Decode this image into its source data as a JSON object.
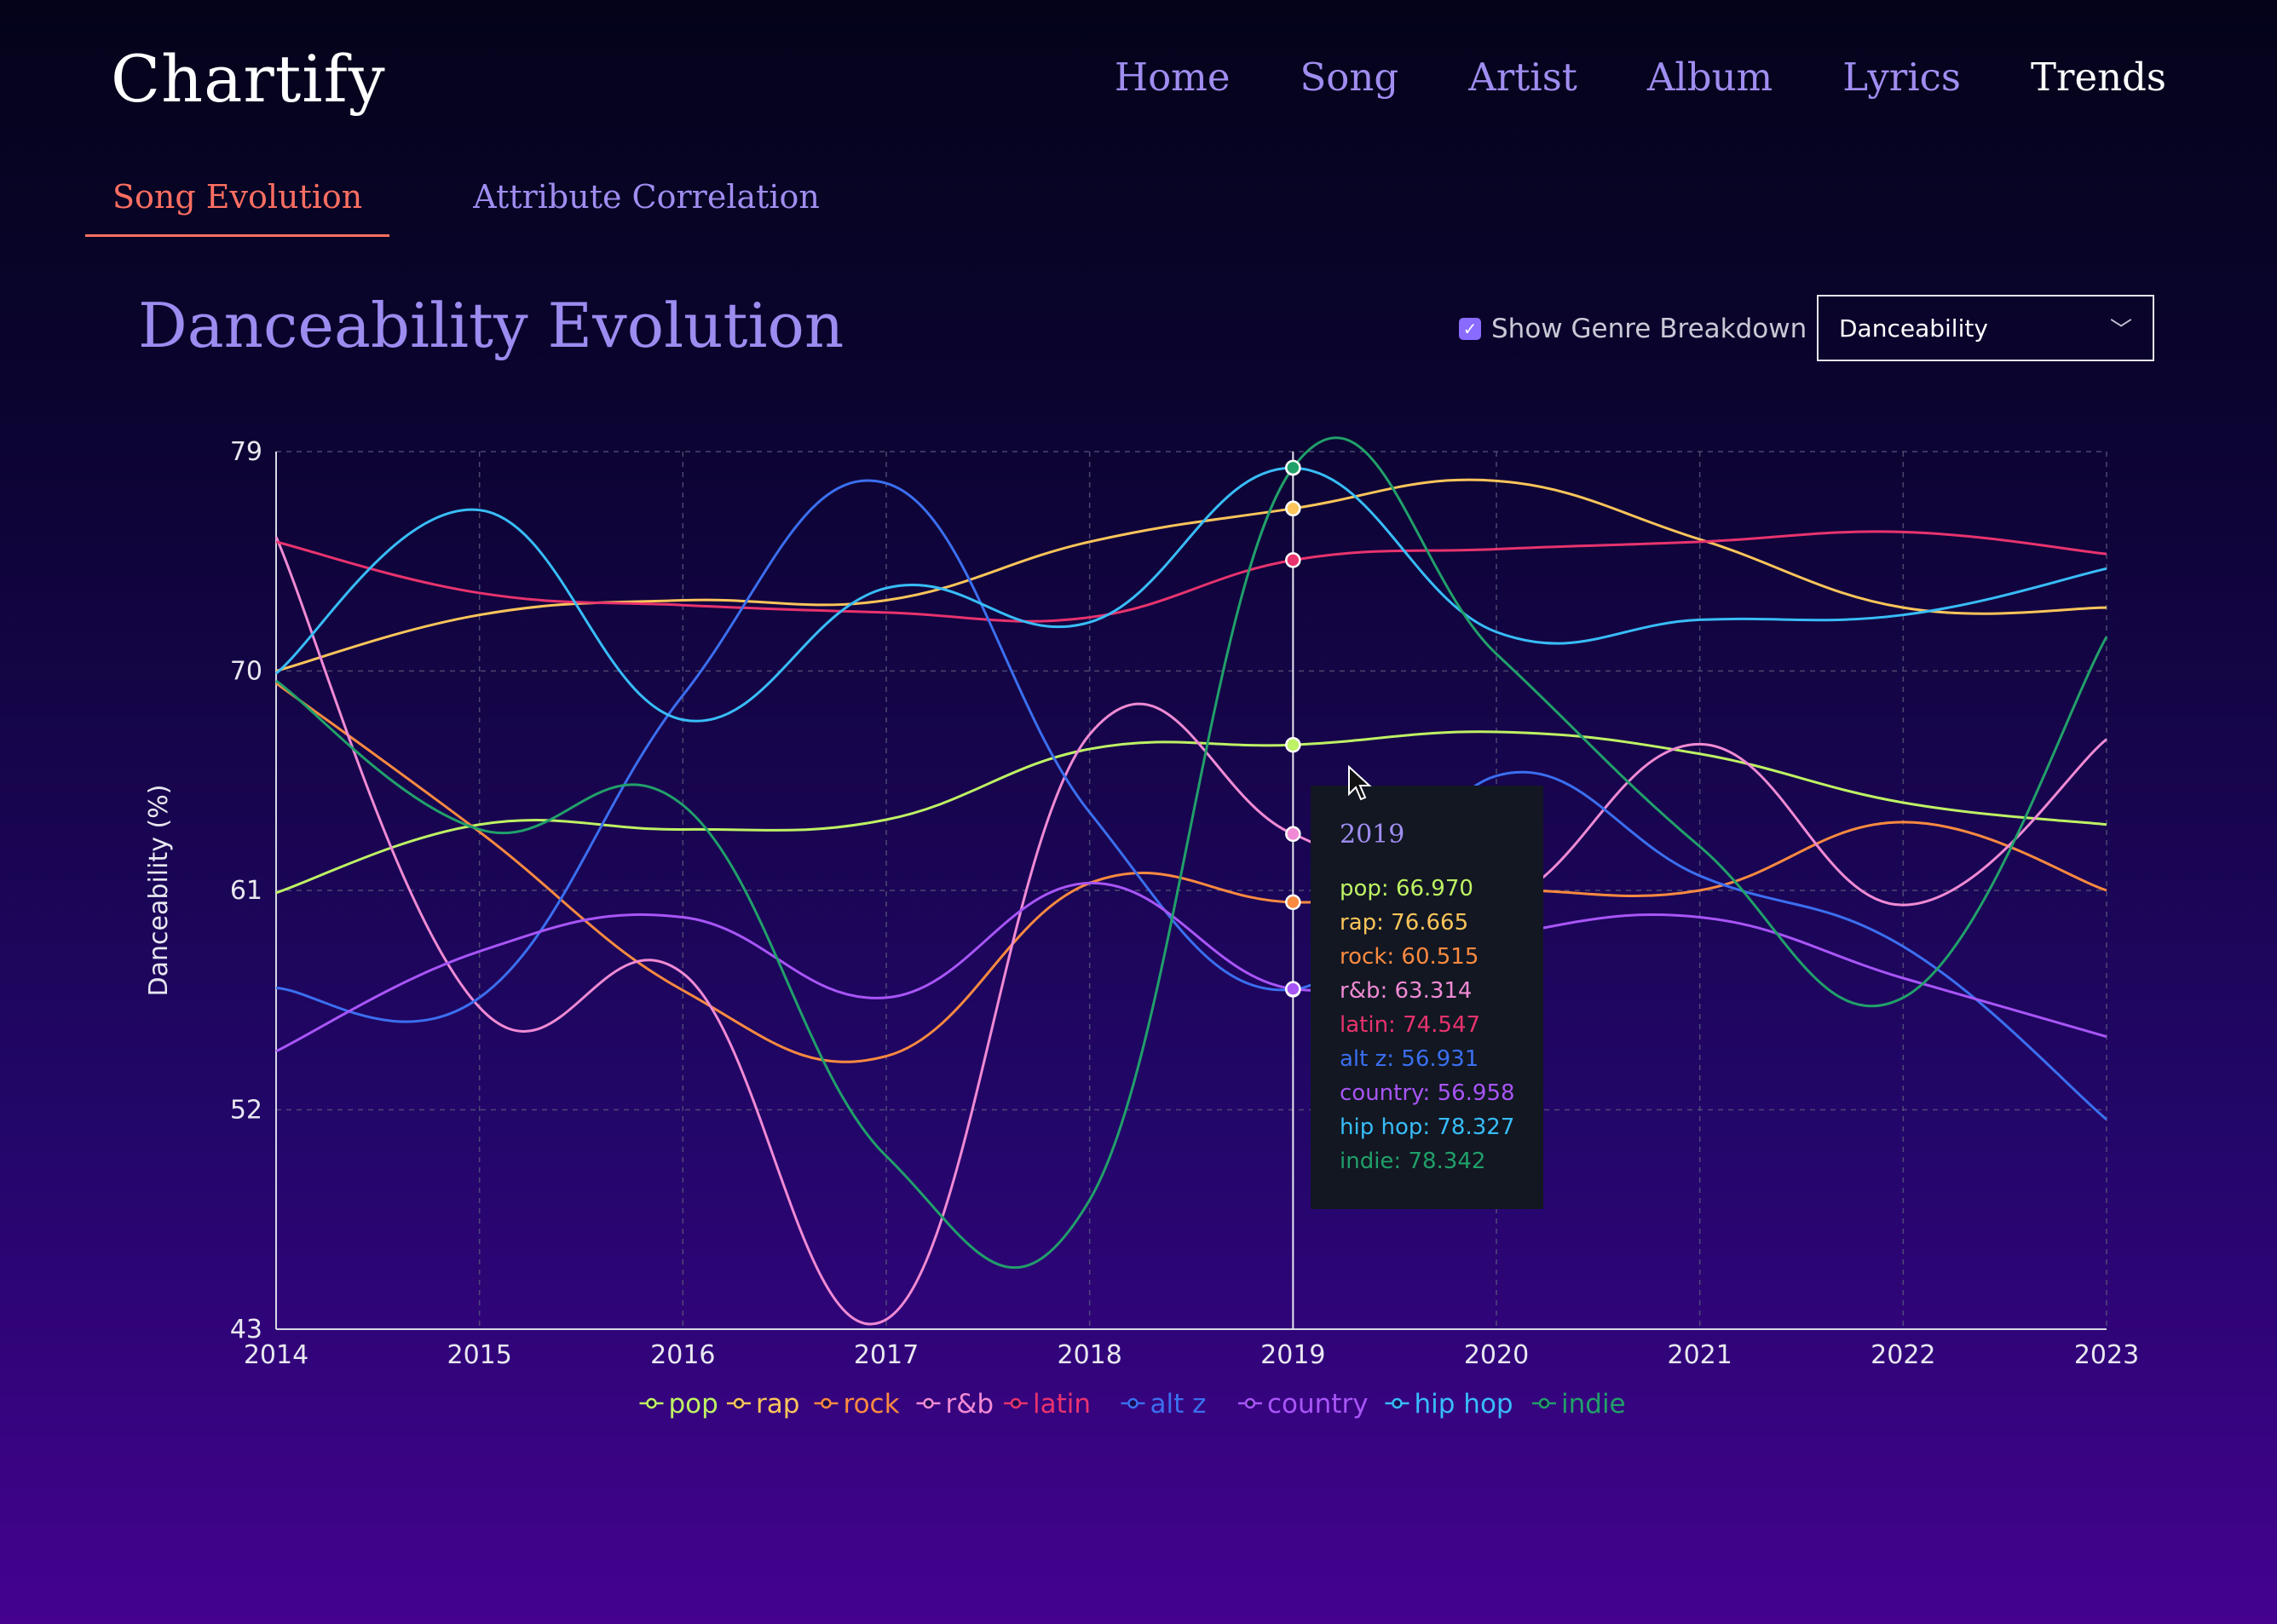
{
  "app": {
    "title": "Chartify"
  },
  "nav": [
    {
      "label": "Home",
      "active": false
    },
    {
      "label": "Song",
      "active": false
    },
    {
      "label": "Artist",
      "active": false
    },
    {
      "label": "Album",
      "active": false
    },
    {
      "label": "Lyrics",
      "active": false
    },
    {
      "label": "Trends",
      "active": true
    }
  ],
  "subtabs": [
    {
      "label": "Song Evolution",
      "active": true
    },
    {
      "label": "Attribute Correlation",
      "active": false
    }
  ],
  "page": {
    "title": "Danceability Evolution"
  },
  "controls": {
    "breakdown_label": "Show Genre Breakdown",
    "breakdown_checked": true,
    "attribute_select": "Danceability"
  },
  "colors": {
    "accent": "#a08df0",
    "active_tab": "#ff6f61",
    "tooltip_bg": "#121722"
  },
  "icons": {
    "checkbox": "check-icon",
    "select": "chevron-down-icon",
    "cursor": "mouse-pointer-icon"
  },
  "tooltip": {
    "title": "2019",
    "rows": [
      {
        "name": "pop",
        "value": "66.970"
      },
      {
        "name": "rap",
        "value": "76.665"
      },
      {
        "name": "rock",
        "value": "60.515"
      },
      {
        "name": "r&b",
        "value": "63.314"
      },
      {
        "name": "latin",
        "value": "74.547"
      },
      {
        "name": "alt z",
        "value": "56.931"
      },
      {
        "name": "country",
        "value": "56.958"
      },
      {
        "name": "hip hop",
        "value": "78.327"
      },
      {
        "name": "indie",
        "value": "78.342"
      }
    ]
  },
  "chart_data": {
    "type": "line",
    "title": "",
    "xlabel": "",
    "ylabel": "Danceability (%)",
    "x": [
      2014,
      2015,
      2016,
      2017,
      2018,
      2019,
      2020,
      2021,
      2022,
      2023
    ],
    "ylim": [
      43,
      79
    ],
    "yticks": [
      43,
      52,
      61,
      70,
      79
    ],
    "grid": true,
    "legend_position": "bottom",
    "hover_x": 2019,
    "series": [
      {
        "name": "pop",
        "color": "#bef264",
        "values": [
          60.9,
          63.7,
          63.5,
          63.9,
          66.8,
          66.97,
          67.5,
          66.6,
          64.6,
          63.7
        ]
      },
      {
        "name": "rap",
        "color": "#fcc55a",
        "values": [
          70.0,
          72.3,
          72.9,
          72.9,
          75.3,
          76.665,
          77.8,
          75.4,
          72.6,
          72.6
        ]
      },
      {
        "name": "rock",
        "color": "#fb8a40",
        "values": [
          69.5,
          63.4,
          56.9,
          54.2,
          61.3,
          60.515,
          61.0,
          61.0,
          63.8,
          61.0
        ]
      },
      {
        "name": "r&b",
        "color": "#f08ad4",
        "values": [
          75.5,
          56.2,
          57.6,
          43.4,
          67.4,
          63.314,
          60.5,
          67.0,
          60.4,
          67.2
        ]
      },
      {
        "name": "latin",
        "color": "#e8336e",
        "values": [
          75.3,
          73.2,
          72.7,
          72.4,
          72.2,
          74.547,
          75.0,
          75.3,
          75.7,
          74.8
        ]
      },
      {
        "name": "alt z",
        "color": "#3b6ff0",
        "values": [
          57.0,
          56.6,
          69.0,
          77.7,
          64.2,
          56.931,
          65.7,
          61.6,
          58.7,
          51.6
        ]
      },
      {
        "name": "country",
        "color": "#a855f7",
        "values": [
          54.4,
          58.5,
          59.9,
          56.6,
          61.3,
          56.958,
          59.1,
          59.9,
          57.4,
          55.0
        ]
      },
      {
        "name": "hip hop",
        "color": "#38bdf8",
        "values": [
          69.9,
          76.6,
          68.0,
          73.4,
          72.0,
          78.327,
          71.6,
          72.1,
          72.3,
          74.2
        ]
      },
      {
        "name": "indie",
        "color": "#21a06a",
        "values": [
          69.6,
          63.5,
          64.5,
          50.1,
          48.3,
          78.342,
          70.7,
          62.8,
          56.6,
          71.4
        ]
      }
    ]
  }
}
